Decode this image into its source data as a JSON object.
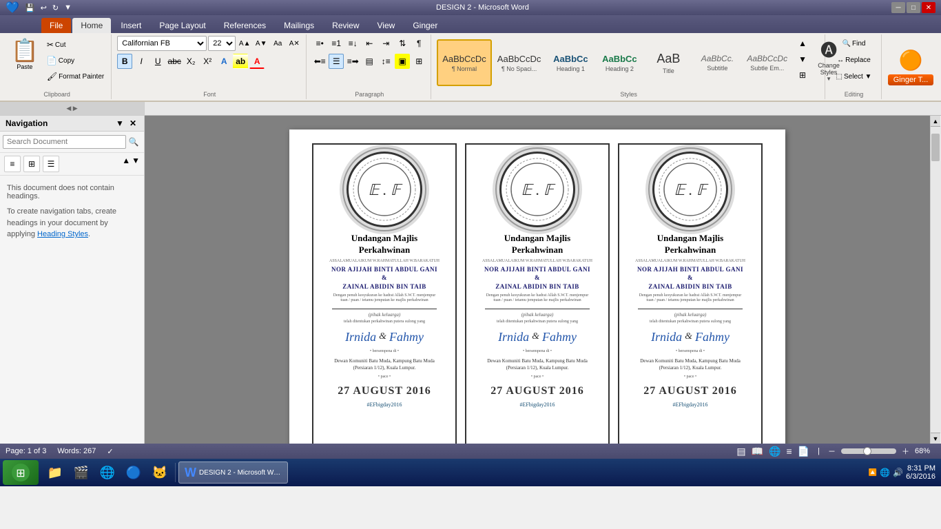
{
  "titlebar": {
    "title": "DESIGN 2 - Microsoft Word",
    "min": "─",
    "max": "□",
    "close": "✕",
    "quickaccess": [
      "↩",
      "↻",
      "💾",
      "▼"
    ]
  },
  "ribbon": {
    "tabs": [
      "File",
      "Home",
      "Insert",
      "Page Layout",
      "References",
      "Mailings",
      "Review",
      "View",
      "Ginger"
    ],
    "active_tab": "Home",
    "clipboard": {
      "label": "Clipboard",
      "paste_label": "Paste",
      "cut_label": "Cut",
      "copy_label": "Copy",
      "format_painter_label": "Format Painter"
    },
    "font": {
      "label": "Font",
      "current_font": "Californian FB",
      "current_size": "22",
      "bold": "B",
      "italic": "I",
      "underline": "U",
      "strikethrough": "abc",
      "subscript": "X₂",
      "superscript": "X²"
    },
    "paragraph": {
      "label": "Paragraph"
    },
    "styles": {
      "label": "Styles",
      "items": [
        {
          "name": "Normal",
          "preview": "AaBbCcDc",
          "label": "¶ Normal",
          "active": true
        },
        {
          "name": "No Spacing",
          "preview": "AaBbCcDc",
          "label": "¶ No Spaci..."
        },
        {
          "name": "Heading 1",
          "preview": "AaBbCc",
          "label": "Heading 1"
        },
        {
          "name": "Heading 2",
          "preview": "AaBbCc",
          "label": "Heading 2"
        },
        {
          "name": "Title",
          "preview": "AaB",
          "label": "Title"
        },
        {
          "name": "Subtitle",
          "preview": "AaBbCc.",
          "label": "Subtitle"
        },
        {
          "name": "Subtle Em",
          "preview": "AaBbCcDc",
          "label": "Subtle Em..."
        }
      ],
      "change_styles_label": "Change\nStyles"
    },
    "editing": {
      "label": "Editing",
      "find_label": "Find",
      "replace_label": "Replace",
      "select_label": "Select ▼"
    },
    "ginger": {
      "label": "Ginger",
      "tab_label": "Ginger T..."
    }
  },
  "navigation": {
    "title": "Navigation",
    "close_label": "✕",
    "search_placeholder": "Search Document",
    "search_btn": "🔍",
    "views": [
      "≡",
      "⊞",
      "☰"
    ],
    "info_text": "This document does not contain headings.",
    "link_text": "To create navigation tabs, create headings in your document by applying Heading Styles."
  },
  "document": {
    "cards": [
      {
        "monogram": "E . F",
        "title": "Undangan  Majlis\nPerkahwinan",
        "subtitle_small": "ASSALAMUALAIKUM    W.RAHMATULLAH    W.BARAKATUH",
        "groom": "NOR AJIJAH BINTI ABDUL GANI",
        "bride": "ZAINAL ABIDIN BIN TAIB",
        "body_text": "Dengan penuh kesyukuran ke hadrat Allah S.W.T. menjemput",
        "address_small": "tuan / puan / tetamu jemputan ke majlis perkahwinan",
        "italic_small": "(pihak keluarga)",
        "invite_text": "telah ditentukan perkahwinan putera sulong yang",
        "couple_name1": "Irnida",
        "ampersand": "&",
        "couple_name2": "Fahmy",
        "bersempena": "bersempena di",
        "venue": "Dewan Komuniti Batu Muda, Kampung Batu Muda\n(Persiaran 1/12), Kuala Lumpur.",
        "pace": "• pace •",
        "date": "27 AUGUST 2016",
        "hashtag": "#EFbigday2016"
      },
      {
        "monogram": "E . F",
        "title": "Undangan  Majlis\nPerkahwinan",
        "subtitle_small": "ASSALAMUALAIKUM    W.RAHMATULLAH    W.BARAKATUH",
        "groom": "NOR AJIJAH BINTI ABDUL GANI",
        "bride": "ZAINAL ABIDIN BIN TAIB",
        "body_text": "Dengan penuh kesyukuran ke hadrat Allah S.W.T. menjemput",
        "address_small": "tuan / puan / tetamu jemputan ke majlis perkahwinan",
        "italic_small": "(pihak keluarga)",
        "invite_text": "telah ditentukan perkahwinan putera sulong yang",
        "couple_name1": "Irnida",
        "ampersand": "&",
        "couple_name2": "Fahmy",
        "bersempena": "bersempena di",
        "venue": "Dewan Komuniti Batu Muda, Kampung Batu Muda\n(Persiaran 1/12), Kuala Lumpur.",
        "pace": "• pace •",
        "date": "27 AUGUST 2016",
        "hashtag": "#EFbigday2016"
      },
      {
        "monogram": "E . F",
        "title": "Undangan  Majlis\nPerkahwinan",
        "subtitle_small": "ASSALAMUALAIKUM    W.RAHMATULLAH    W.BARAKATUH",
        "groom": "NOR AJIJAH BINTI ABDUL GANI",
        "bride": "ZAINAL ABIDIN BIN TAIB",
        "body_text": "Dengan penuh kesyukuran ke hadrat Allah S.W.T. menjemput",
        "address_small": "tuan / puan / tetamu jemputan ke majlis perkahwinan",
        "italic_small": "(pihak keluarga)",
        "invite_text": "telah ditentukan perkahwinan putera sulong yang",
        "couple_name1": "Irnida",
        "ampersand": "&",
        "couple_name2": "Fahmy",
        "bersempena": "bersempena di",
        "venue": "Dewan Komuniti Batu Muda, Kampung Batu Muda\n(Persiaran 1/12), Kuala Lumpur.",
        "pace": "• pace •",
        "date": "27 AUGUST 2016",
        "hashtag": "#EFbigday2016"
      }
    ]
  },
  "statusbar": {
    "page": "Page: 1 of 3",
    "words": "Words: 267",
    "zoom": "68%"
  },
  "taskbar": {
    "time": "8:31 PM",
    "date": "6/3/2016"
  }
}
